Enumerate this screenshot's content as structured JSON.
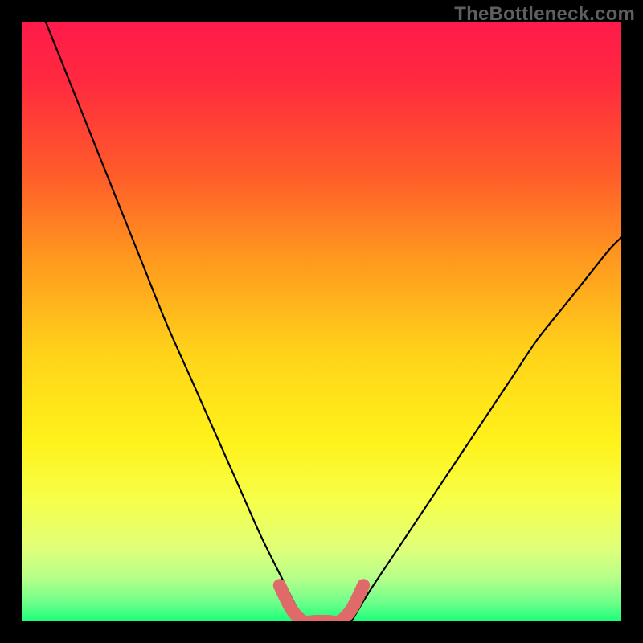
{
  "watermark": "TheBottleneck.com",
  "chart_data": {
    "type": "line",
    "title": "",
    "xlabel": "",
    "ylabel": "",
    "xlim": [
      0,
      100
    ],
    "ylim": [
      0,
      100
    ],
    "series": [
      {
        "name": "left-curve",
        "x": [
          4,
          8,
          12,
          16,
          20,
          24,
          28,
          32,
          36,
          40,
          44,
          47
        ],
        "y": [
          100,
          90,
          80,
          70,
          60,
          50,
          41,
          32,
          23,
          14,
          6,
          0
        ]
      },
      {
        "name": "right-curve",
        "x": [
          55,
          58,
          62,
          66,
          70,
          74,
          78,
          82,
          86,
          90,
          94,
          98,
          100
        ],
        "y": [
          0,
          5,
          11,
          17,
          23,
          29,
          35,
          41,
          47,
          52,
          57,
          62,
          64
        ]
      },
      {
        "name": "highlight-segment",
        "x": [
          43,
          45,
          47,
          49,
          51,
          53,
          55,
          57
        ],
        "y": [
          6,
          2,
          0,
          0,
          0,
          0,
          2,
          6
        ]
      }
    ],
    "gradient_stops": [
      {
        "offset": 0.0,
        "color": "#ff1a4b"
      },
      {
        "offset": 0.1,
        "color": "#ff2a3f"
      },
      {
        "offset": 0.25,
        "color": "#ff5a2a"
      },
      {
        "offset": 0.4,
        "color": "#ff9a1e"
      },
      {
        "offset": 0.55,
        "color": "#ffd21a"
      },
      {
        "offset": 0.7,
        "color": "#fff21a"
      },
      {
        "offset": 0.8,
        "color": "#f6ff4a"
      },
      {
        "offset": 0.88,
        "color": "#dfff7a"
      },
      {
        "offset": 0.93,
        "color": "#b3ff8a"
      },
      {
        "offset": 0.97,
        "color": "#6bff8a"
      },
      {
        "offset": 1.0,
        "color": "#1aff7a"
      }
    ],
    "highlight_color": "#e06a6a",
    "curve_color": "#000000"
  }
}
